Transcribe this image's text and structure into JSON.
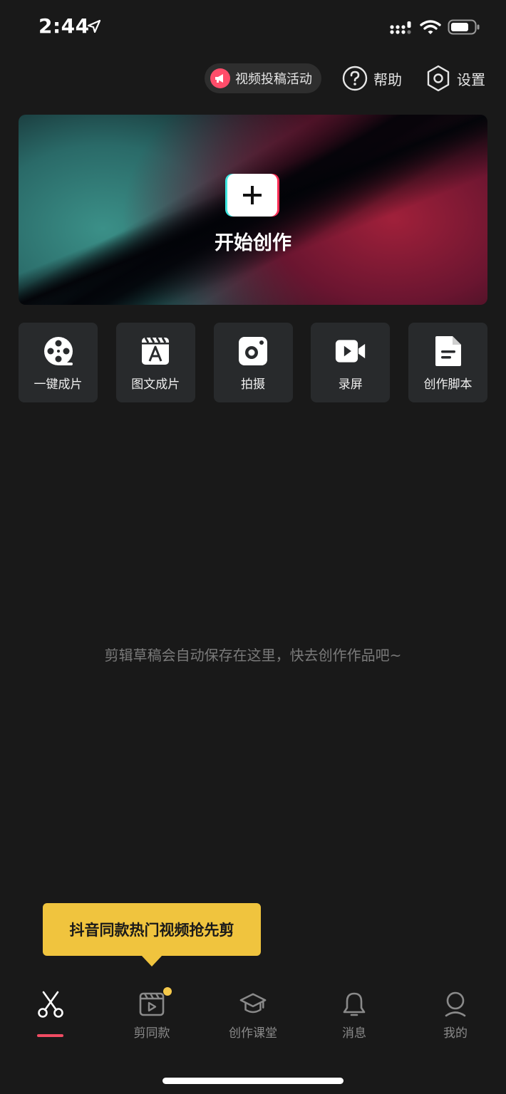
{
  "status_bar": {
    "time": "2:44"
  },
  "header": {
    "promo_label": "视频投稿活动",
    "help_label": "帮助",
    "settings_label": "设置"
  },
  "hero": {
    "title": "开始创作"
  },
  "tools": [
    {
      "label": "一键成片",
      "icon": "film-reel-icon"
    },
    {
      "label": "图文成片",
      "icon": "clapper-text-icon"
    },
    {
      "label": "拍摄",
      "icon": "camera-icon"
    },
    {
      "label": "录屏",
      "icon": "screen-record-icon"
    },
    {
      "label": "创作脚本",
      "icon": "script-document-icon"
    }
  ],
  "empty_state": "剪辑草稿会自动保存在这里，快去创作作品吧~",
  "tooltip": "抖音同款热门视频抢先剪",
  "nav": [
    {
      "label": "",
      "icon": "scissors-icon",
      "active": true
    },
    {
      "label": "剪同款",
      "icon": "template-clapper-icon",
      "badge": true
    },
    {
      "label": "创作课堂",
      "icon": "graduation-cap-icon"
    },
    {
      "label": "消息",
      "icon": "bell-icon"
    },
    {
      "label": "我的",
      "icon": "profile-icon"
    }
  ],
  "colors": {
    "background": "#191919",
    "accent_red": "#f14c63",
    "tooltip_yellow": "#f0c43e",
    "tool_card": "#282a2c"
  }
}
